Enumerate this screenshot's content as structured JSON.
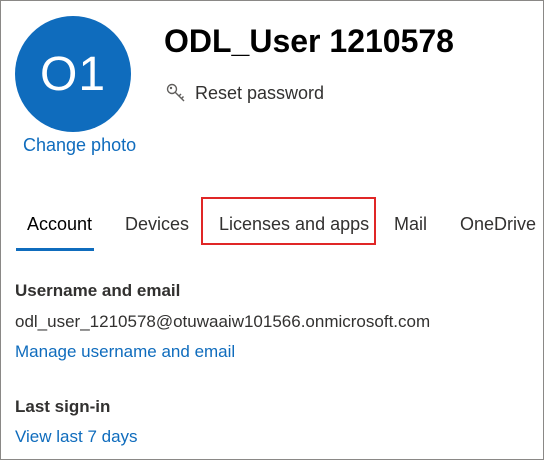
{
  "profile": {
    "initials": "O1",
    "change_photo": "Change photo",
    "display_name": "ODL_User 1210578",
    "reset_password": "Reset password",
    "reset_icon": "key-icon"
  },
  "tabs": [
    {
      "label": "Account",
      "active": true
    },
    {
      "label": "Devices",
      "active": false
    },
    {
      "label": "Licenses and apps",
      "active": false,
      "highlighted": true
    },
    {
      "label": "Mail",
      "active": false
    },
    {
      "label": "OneDrive",
      "active": false
    }
  ],
  "account": {
    "username_heading": "Username and email",
    "username_value": "odl_user_1210578@otuwaaiw101566.onmicrosoft.com",
    "manage_link": "Manage username and email",
    "last_signin_heading": "Last sign-in",
    "last_signin_link": "View last 7 days"
  },
  "colors": {
    "accent": "#0f6cbd",
    "highlight": "#e02626",
    "text": "#323130"
  }
}
